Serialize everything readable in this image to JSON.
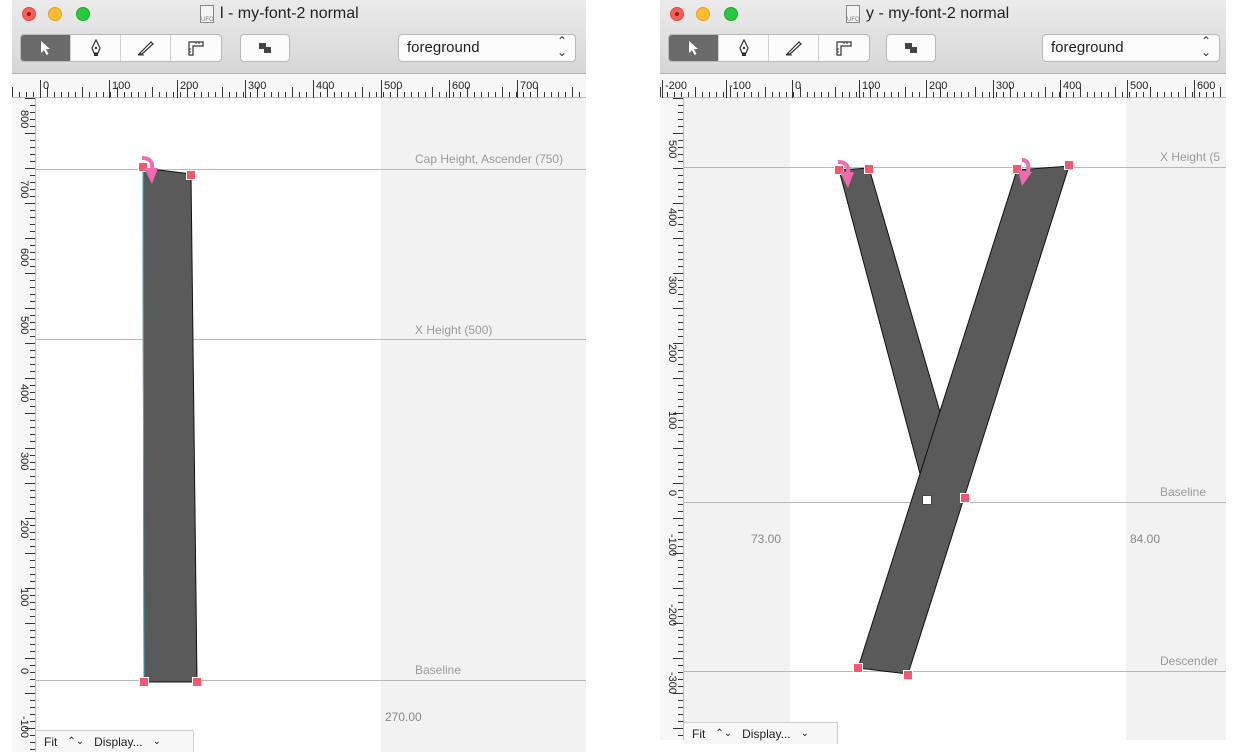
{
  "windows": [
    {
      "title": "l - my-font-2 normal",
      "layer": "foreground",
      "ruler_h_labels": [
        "0",
        "100",
        "200",
        "300",
        "400",
        "500",
        "600",
        "700"
      ],
      "ruler_v_labels": [
        "800",
        "700",
        "600",
        "500",
        "400",
        "300",
        "200",
        "100",
        "0",
        "-100"
      ],
      "guidelines": {
        "cap": "Cap Height, Ascender (750)",
        "xheight": "X Height (500)",
        "baseline": "Baseline"
      },
      "advance_width": "270.00",
      "bottom": {
        "zoom": "Fit",
        "display": "Display..."
      }
    },
    {
      "title": "y - my-font-2 normal",
      "layer": "foreground",
      "ruler_h_labels": [
        "-200",
        "-100",
        "0",
        "100",
        "200",
        "300",
        "400",
        "500",
        "600"
      ],
      "ruler_v_labels": [
        "500",
        "400",
        "300",
        "200",
        "100",
        "0",
        "-100",
        "-200",
        "-300"
      ],
      "guidelines": {
        "xheight": "X Height (5",
        "baseline": "Baseline",
        "descender": "Descender"
      },
      "left_sidebearing": "73.00",
      "right_sidebearing": "84.00",
      "bottom": {
        "zoom": "Fit",
        "display": "Display..."
      }
    }
  ],
  "colors": {
    "glyph_fill": "#5a5a5a",
    "point": "#f4586a",
    "direction_arrow": "#f06ab0",
    "margin_bg": "#f2f2f2"
  },
  "icons": [
    "pointer-icon",
    "pen-icon",
    "knife-icon",
    "ruler-icon",
    "layers-icon"
  ]
}
